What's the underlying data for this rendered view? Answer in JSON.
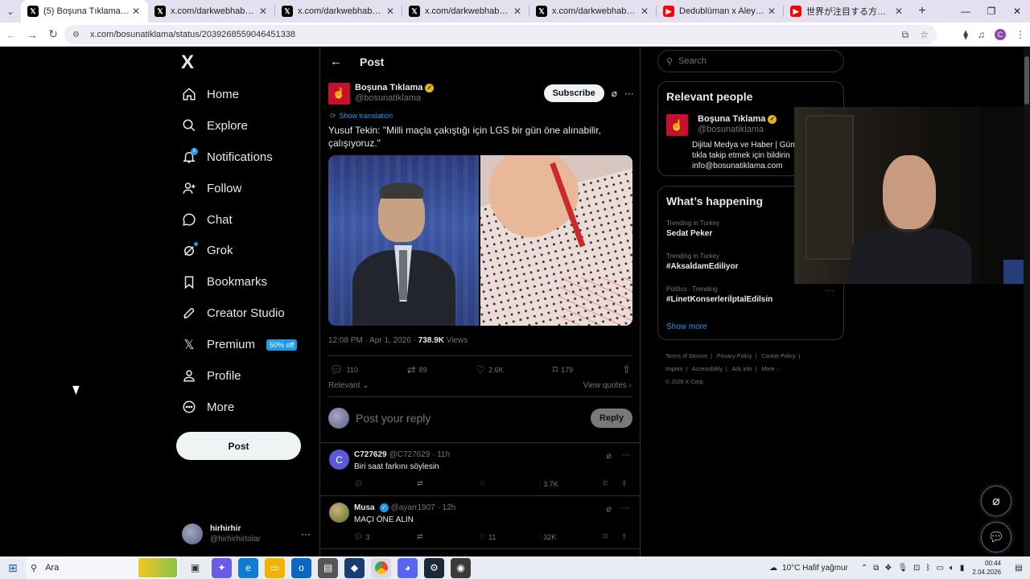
{
  "browser": {
    "tabs": [
      {
        "favicon": "x",
        "title": "(5) Boşuna Tıklama on X: \"Yusuf",
        "active": true
      },
      {
        "favicon": "x",
        "title": "x.com/darkwebhaber/status/20",
        "active": false
      },
      {
        "favicon": "x",
        "title": "x.com/darkwebhaber/status/20",
        "active": false
      },
      {
        "favicon": "x",
        "title": "x.com/darkwebhaber/status/20",
        "active": false
      },
      {
        "favicon": "x",
        "title": "x.com/darkwebhaber/status/20",
        "active": false
      },
      {
        "favicon": "yt",
        "title": "Dedublüman x Aleyna Tilki - Sa",
        "active": false
      },
      {
        "favicon": "yt",
        "title": "世界が注目する方のバーテンダー",
        "active": false
      }
    ],
    "url": "x.com/bosunatiklama/status/2039268559046451338",
    "profile_initial": "C"
  },
  "sidebar": {
    "logo": "X",
    "nav": [
      {
        "label": "Home",
        "icon": "home-icon"
      },
      {
        "label": "Explore",
        "icon": "search-icon"
      },
      {
        "label": "Notifications",
        "icon": "bell-icon",
        "badge": "5"
      },
      {
        "label": "Follow",
        "icon": "person-add-icon"
      },
      {
        "label": "Chat",
        "icon": "chat-icon"
      },
      {
        "label": "Grok",
        "icon": "grok-icon"
      },
      {
        "label": "Bookmarks",
        "icon": "bookmark-icon"
      },
      {
        "label": "Creator Studio",
        "icon": "rocket-icon"
      },
      {
        "label": "Premium",
        "icon": "x-icon",
        "promo": "50% off"
      },
      {
        "label": "Profile",
        "icon": "person-icon"
      },
      {
        "label": "More",
        "icon": "more-circle-icon"
      }
    ],
    "post_button": "Post",
    "account": {
      "name": "hirhirhir",
      "handle": "@hirhirhirtolar"
    }
  },
  "post": {
    "header_title": "Post",
    "author_name": "Boşuna Tıklama",
    "author_handle": "@bosunatiklama",
    "subscribe_label": "Subscribe",
    "show_translation": "Show translation",
    "text": "Yusuf Tekin: \"Milli maçla çakıştığı için LGS bir gün öne alınabilir, çalışıyoruz.\"",
    "time": "12:08 PM · Apr 1, 2026 · ",
    "views_count": "738.9K",
    "views_label": " Views",
    "stats": {
      "replies": "110",
      "reposts": "89",
      "likes": "2.6K",
      "bookmarks": "179"
    },
    "sort_label": "Relevant",
    "view_quotes": "View quotes",
    "reply_placeholder": "Post your reply",
    "reply_button": "Reply"
  },
  "replies": [
    {
      "name": "C727629",
      "handle": "@C727629",
      "time": "11h",
      "avatar": "C",
      "verified": false,
      "text": "Biri saat farkını söylesin",
      "replies": "",
      "reposts": "",
      "likes": "",
      "views": "3.7K"
    },
    {
      "name": "Musa",
      "handle": "@ayarr1907",
      "time": "12h",
      "avatar": "",
      "verified": true,
      "text": "MAÇI ÖNE ALIN",
      "replies": "3",
      "reposts": "",
      "likes": "11",
      "views": "32K"
    }
  ],
  "right": {
    "search_placeholder": "Search",
    "relevant_title": "Relevant people",
    "rp_name": "Boşuna Tıklama",
    "rp_handle": "@bosunatiklama",
    "rp_bio_lines": [
      "Dijital Medya ve Haber | Gün",
      "tıkla takip etmek için bildirin",
      "info@bosunatiklama.com"
    ],
    "happening_title": "What’s happening",
    "trends": [
      {
        "category": "Trending in Turkey",
        "name": "Sedat Peker"
      },
      {
        "category": "Trending in Turkey",
        "name": "#AksaİdamEdiliyor"
      },
      {
        "category": "Politics · Trending",
        "name": "#LinetKonserleriİptalEdilsin"
      }
    ],
    "show_more": "Show more",
    "footer": [
      "Terms of Service",
      "|",
      "Privacy Policy",
      "|",
      "Cookie Policy",
      "|",
      "Imprint",
      "|",
      "Accessibility",
      "|",
      "Ads info",
      "|",
      "More ···",
      "© 2026 X Corp."
    ]
  },
  "taskbar": {
    "search_label": "Ara",
    "weather": "10°C  Hafif yağmur",
    "time": "00:44",
    "date": "2.04.2026"
  },
  "colors": {
    "accent": "#1d9bf0",
    "verified_gold": "#e6b322",
    "brand_red": "#c8102e"
  }
}
